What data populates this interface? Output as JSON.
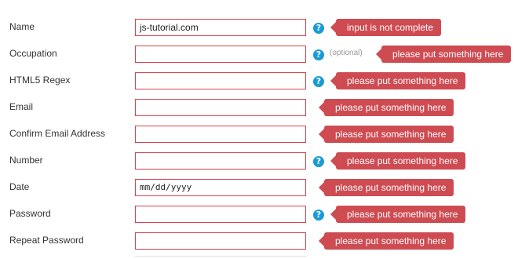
{
  "rows": [
    {
      "label": "Name",
      "value": "js-tutorial.com",
      "help": "?",
      "optional": "",
      "error": "input is not complete"
    },
    {
      "label": "Occupation",
      "value": "",
      "help": "?",
      "optional": "(optional)",
      "error": "please put something here"
    },
    {
      "label": "HTML5 Regex",
      "value": "",
      "help": "?",
      "optional": "",
      "error": "please put something here"
    },
    {
      "label": "Email",
      "value": "",
      "help": "",
      "optional": "",
      "error": "please put something here"
    },
    {
      "label": "Confirm Email Address",
      "value": "",
      "help": "",
      "optional": "",
      "error": "please put something here"
    },
    {
      "label": "Number",
      "value": "",
      "help": "?",
      "optional": "",
      "error": "please put something here"
    },
    {
      "label": "Date",
      "value": "mm/dd/yyyy",
      "help": "",
      "optional": "",
      "error": "please put something here"
    },
    {
      "label": "Password",
      "value": "",
      "help": "?",
      "optional": "",
      "error": "please put something here"
    },
    {
      "label": "Repeat Password",
      "value": "",
      "help": "",
      "optional": "",
      "error": "please put something here"
    }
  ],
  "colors": {
    "field_border": "#d9434a",
    "error_bg": "#ce4b52",
    "help_bg": "#1a9bd7"
  }
}
